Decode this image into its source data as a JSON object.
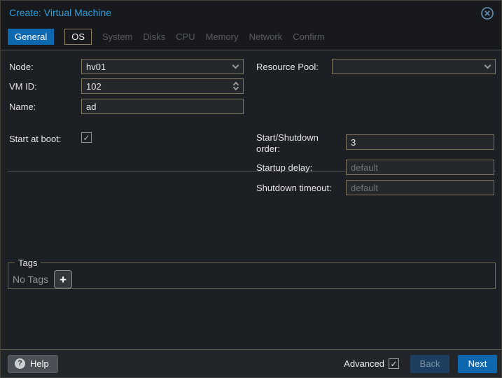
{
  "window": {
    "title": "Create: Virtual Machine"
  },
  "icons": {
    "close": "circled-x",
    "check": "✓",
    "plus": "+",
    "question": "?"
  },
  "tabs": [
    {
      "label": "General",
      "state": "active"
    },
    {
      "label": "OS",
      "state": "enabled"
    },
    {
      "label": "System",
      "state": "disabled"
    },
    {
      "label": "Disks",
      "state": "disabled"
    },
    {
      "label": "CPU",
      "state": "disabled"
    },
    {
      "label": "Memory",
      "state": "disabled"
    },
    {
      "label": "Network",
      "state": "disabled"
    },
    {
      "label": "Confirm",
      "state": "disabled"
    }
  ],
  "form": {
    "node": {
      "label": "Node:",
      "value": "hv01"
    },
    "vmid": {
      "label": "VM ID:",
      "value": "102"
    },
    "name": {
      "label": "Name:",
      "value": "ad"
    },
    "resource_pool": {
      "label": "Resource Pool:",
      "value": ""
    },
    "start_at_boot": {
      "label": "Start at boot:",
      "checked": true
    },
    "order": {
      "label": "Start/Shutdown order:",
      "value": "3"
    },
    "startup_delay": {
      "label": "Startup delay:",
      "placeholder": "default"
    },
    "shutdown_timeout": {
      "label": "Shutdown timeout:",
      "placeholder": "default"
    },
    "tags": {
      "legend": "Tags",
      "empty_text": "No Tags"
    }
  },
  "footer": {
    "help_label": "Help",
    "advanced_label": "Advanced",
    "advanced_checked": true,
    "back_label": "Back",
    "next_label": "Next"
  },
  "colors": {
    "accent_blue": "#0d68b0",
    "title_blue": "#2b9edc",
    "field_border": "#7f765c",
    "panel_bg": "#1c1f23",
    "disabled_tab_text": "#575c61"
  }
}
